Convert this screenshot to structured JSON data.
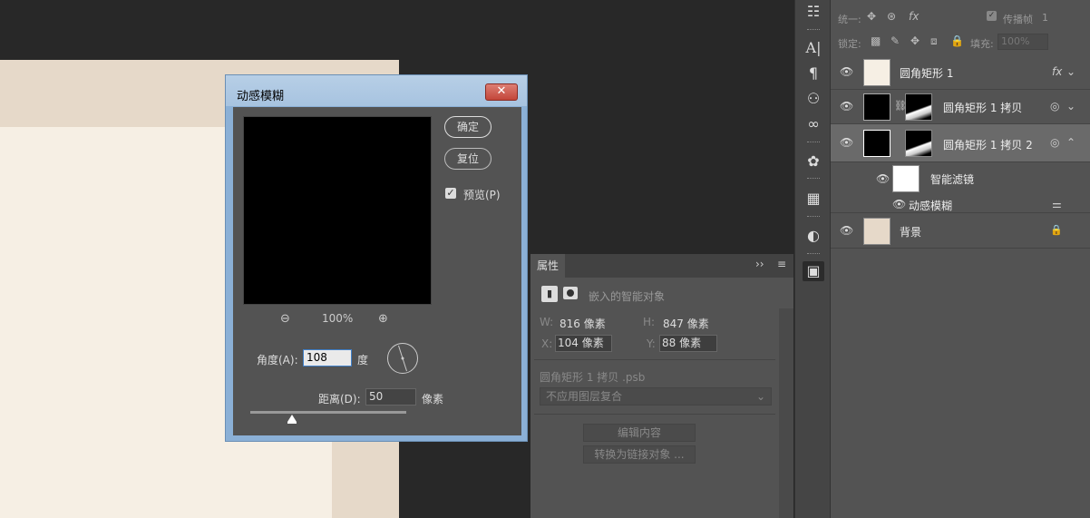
{
  "dialog": {
    "title": "动感模糊",
    "close_label": "✕",
    "ok_label": "确定",
    "reset_label": "复位",
    "preview_label": "预览(P)",
    "preview_checked": true,
    "zoom_out_icon": "⊖",
    "zoom_in_icon": "⊕",
    "zoom_level": "100%",
    "angle_label": "角度(A):",
    "angle_value": "108",
    "angle_unit": "度",
    "distance_label": "距离(D):",
    "distance_value": "50",
    "distance_unit": "像素"
  },
  "properties": {
    "tab_label": "属性",
    "collapse_icon": "››",
    "menu_icon": "≡",
    "object_type": "嵌入的智能对象",
    "w_label": "W:",
    "w_value": "816 像素",
    "h_label": "H:",
    "h_value": "847 像素",
    "x_label": "X:",
    "x_value": "104 像素",
    "y_label": "Y:",
    "y_value": "88 像素",
    "file_name": "圆角矩形 1 拷贝 .psb",
    "comp_select": "不应用图层复合",
    "edit_contents_label": "编辑内容",
    "convert_linked_label": "转换为链接对象 ..."
  },
  "layers_panel": {
    "unify_label": "统一:",
    "propagate_label": "传播帧",
    "propagate_value": "1",
    "lock_label": "锁定:",
    "fill_label": "填充:",
    "fill_value": "100%",
    "layers": [
      {
        "name": "圆角矩形 1",
        "right": "fx"
      },
      {
        "name": "圆角矩形 1 拷贝",
        "right": "◎"
      },
      {
        "name": "圆角矩形 1 拷贝 2",
        "right": "◎"
      },
      {
        "name": "智能滤镜"
      },
      {
        "name": "动感模糊",
        "right": "⚌"
      },
      {
        "name": "背景",
        "right": "🔒"
      }
    ]
  },
  "colors": {
    "canvas_outer": "#e6d9c9",
    "canvas_inner": "#f6efe4",
    "dialog_frame": "#8bb0d6"
  }
}
